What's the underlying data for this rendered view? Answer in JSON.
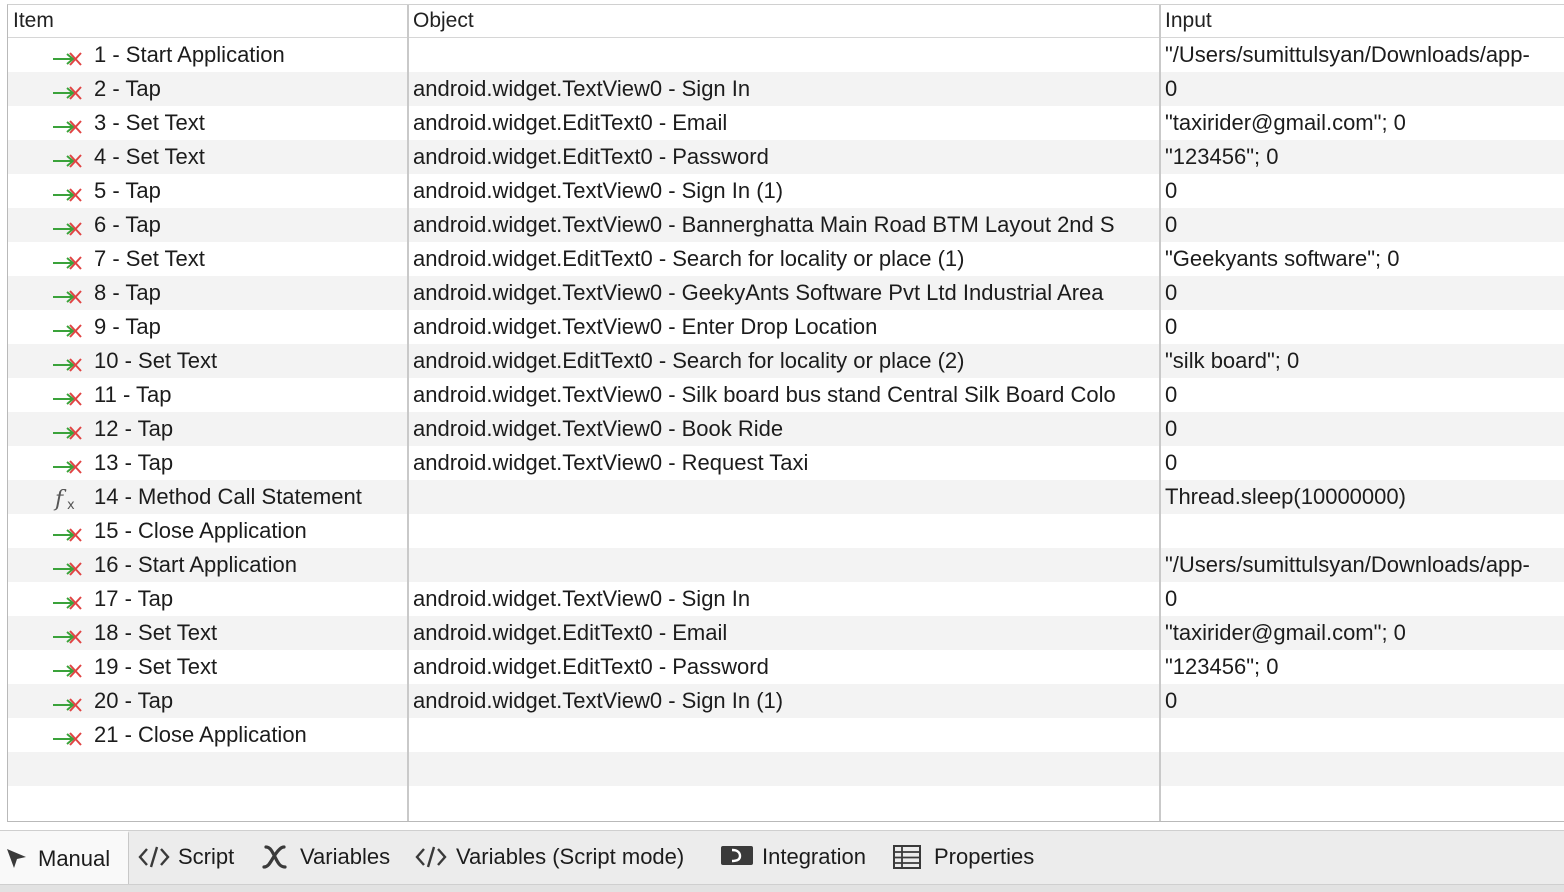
{
  "columns": {
    "item": "Item",
    "object": "Object",
    "input": "Input"
  },
  "rows": [
    {
      "kind": "step",
      "label": "1 - Start Application",
      "object": "",
      "input": "\"/Users/sumittulsyan/Downloads/app-"
    },
    {
      "kind": "step",
      "label": "2 - Tap",
      "object": "android.widget.TextView0 - Sign In",
      "input": "0"
    },
    {
      "kind": "step",
      "label": "3 - Set Text",
      "object": "android.widget.EditText0 - Email",
      "input": "\"taxirider@gmail.com\"; 0"
    },
    {
      "kind": "step",
      "label": "4 - Set Text",
      "object": "android.widget.EditText0 - Password",
      "input": "\"123456\"; 0"
    },
    {
      "kind": "step",
      "label": "5 - Tap",
      "object": "android.widget.TextView0 - Sign In (1)",
      "input": "0"
    },
    {
      "kind": "step",
      "label": "6 - Tap",
      "object": "android.widget.TextView0 - Bannerghatta Main Road BTM Layout 2nd S",
      "input": "0"
    },
    {
      "kind": "step",
      "label": "7 - Set Text",
      "object": "android.widget.EditText0 - Search for locality or place (1)",
      "input": "\"Geekyants software\"; 0"
    },
    {
      "kind": "step",
      "label": "8 - Tap",
      "object": "android.widget.TextView0 - GeekyAnts Software Pvt Ltd Industrial Area",
      "input": "0"
    },
    {
      "kind": "step",
      "label": "9 - Tap",
      "object": "android.widget.TextView0 - Enter Drop Location",
      "input": "0"
    },
    {
      "kind": "step",
      "label": "10 - Set Text",
      "object": "android.widget.EditText0 - Search for locality or place (2)",
      "input": "\"silk board\"; 0"
    },
    {
      "kind": "step",
      "label": "11 - Tap",
      "object": "android.widget.TextView0 - Silk board bus stand Central Silk Board Colo",
      "input": "0"
    },
    {
      "kind": "step",
      "label": "12 - Tap",
      "object": "android.widget.TextView0 - Book Ride",
      "input": "0"
    },
    {
      "kind": "step",
      "label": "13 - Tap",
      "object": "android.widget.TextView0 - Request Taxi",
      "input": "0"
    },
    {
      "kind": "method",
      "label": "14 - Method Call Statement",
      "object": "",
      "input": "Thread.sleep(10000000)"
    },
    {
      "kind": "step",
      "label": "15 - Close Application",
      "object": "",
      "input": ""
    },
    {
      "kind": "step",
      "label": "16 - Start Application",
      "object": "",
      "input": "\"/Users/sumittulsyan/Downloads/app-"
    },
    {
      "kind": "step",
      "label": "17 - Tap",
      "object": "android.widget.TextView0 - Sign In",
      "input": "0"
    },
    {
      "kind": "step",
      "label": "18 - Set Text",
      "object": "android.widget.EditText0 - Email",
      "input": "\"taxirider@gmail.com\"; 0"
    },
    {
      "kind": "step",
      "label": "19 - Set Text",
      "object": "android.widget.EditText0 - Password",
      "input": "\"123456\"; 0"
    },
    {
      "kind": "step",
      "label": "20 - Tap",
      "object": "android.widget.TextView0 - Sign In (1)",
      "input": "0"
    },
    {
      "kind": "step",
      "label": "21 - Close Application",
      "object": "",
      "input": ""
    }
  ],
  "tabs": [
    {
      "label": "Manual",
      "icon": "cursor-arrow-icon",
      "active": true
    },
    {
      "label": "Script",
      "icon": "code-brackets-icon",
      "active": false
    },
    {
      "label": "Variables",
      "icon": "variable-x-icon",
      "active": false
    },
    {
      "label": "Variables (Script mode)",
      "icon": "code-brackets-icon",
      "active": false
    },
    {
      "label": "Integration",
      "icon": "integration-icon",
      "active": false
    },
    {
      "label": "Properties",
      "icon": "table-grid-icon",
      "active": false
    }
  ],
  "colors": {
    "step_icon_arrow": "#3aa23a",
    "step_icon_cross": "#e04343",
    "row_alt": "#f3f3f3"
  }
}
